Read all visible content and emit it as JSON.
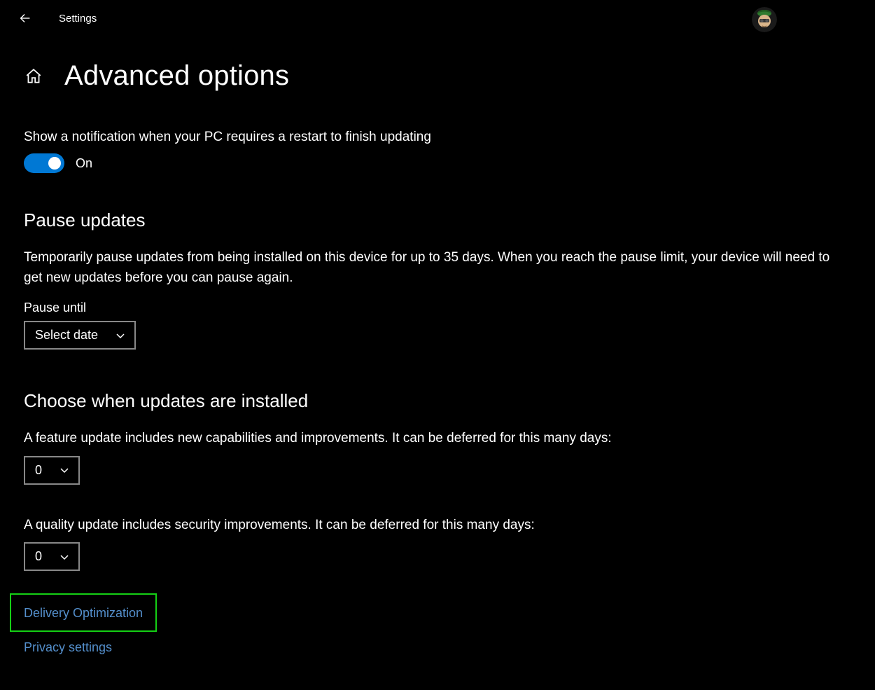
{
  "app_title": "Settings",
  "page_title": "Advanced options",
  "notification": {
    "label": "Show a notification when your PC requires a restart to finish updating",
    "toggle_state": "On"
  },
  "pause": {
    "heading": "Pause updates",
    "description": "Temporarily pause updates from being installed on this device for up to 35 days. When you reach the pause limit, your device will need to get new updates before you can pause again.",
    "field_label": "Pause until",
    "dropdown_value": "Select date"
  },
  "choose": {
    "heading": "Choose when updates are installed",
    "feature_label": "A feature update includes new capabilities and improvements. It can be deferred for this many days:",
    "feature_value": "0",
    "quality_label": "A quality update includes security improvements. It can be deferred for this many days:",
    "quality_value": "0"
  },
  "links": {
    "delivery": "Delivery Optimization",
    "privacy": "Privacy settings"
  }
}
